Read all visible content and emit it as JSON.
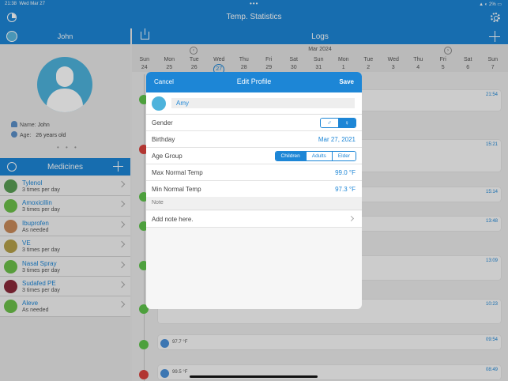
{
  "status": {
    "time": "21:38",
    "date": "Wed Mar 27",
    "dots": "•••",
    "battery": "2%"
  },
  "app": {
    "title": "Temp. Statistics"
  },
  "profile": {
    "name": "John",
    "name_label": "Name:",
    "name_value": "John",
    "age_label": "Age:",
    "age_value": "26 years old",
    "page_dots": "• • •"
  },
  "medicines": {
    "title": "Medicines",
    "items": [
      {
        "name": "Tylenol",
        "freq": "3 times per day",
        "color": "#5a9e55"
      },
      {
        "name": "Amoxicillin",
        "freq": "3 times per day",
        "color": "#6cc04a"
      },
      {
        "name": "Ibuprofen",
        "freq": "As needed",
        "color": "#c88a5a"
      },
      {
        "name": "VE",
        "freq": "3 times per day",
        "color": "#b5a04a"
      },
      {
        "name": "Nasal Spray",
        "freq": "3 times per day",
        "color": "#6cc04a"
      },
      {
        "name": "Sudafed PE",
        "freq": "3 times per day",
        "color": "#8a2a3a"
      },
      {
        "name": "Aleve",
        "freq": "As needed",
        "color": "#6cc04a"
      }
    ]
  },
  "logs": {
    "title": "Logs",
    "month": "Mar 2024",
    "prev": "‹",
    "next": "›",
    "days": [
      {
        "dow": "Sun",
        "num": "24"
      },
      {
        "dow": "Mon",
        "num": "25"
      },
      {
        "dow": "Tue",
        "num": "26"
      },
      {
        "dow": "Wed",
        "num": "27"
      },
      {
        "dow": "Thu",
        "num": "28"
      },
      {
        "dow": "Fri",
        "num": "29"
      },
      {
        "dow": "Sat",
        "num": "30"
      },
      {
        "dow": "Sun",
        "num": "31"
      },
      {
        "dow": "Mon",
        "num": "1"
      },
      {
        "dow": "Tue",
        "num": "2"
      },
      {
        "dow": "Wed",
        "num": "3"
      },
      {
        "dow": "Thu",
        "num": "4"
      },
      {
        "dow": "Fri",
        "num": "5"
      },
      {
        "dow": "Sat",
        "num": "6"
      },
      {
        "dow": "Sun",
        "num": "7"
      }
    ],
    "entries": [
      {
        "time": "21:54",
        "text": ""
      },
      {
        "time": "15:21",
        "text": ""
      },
      {
        "time": "15:14",
        "text": ""
      },
      {
        "time": "13:48",
        "text": ""
      },
      {
        "time": "13:09",
        "text": ""
      },
      {
        "time": "10:23",
        "text": ""
      },
      {
        "time": "09:54",
        "text": "97.7 °F"
      },
      {
        "time": "08:49",
        "text": "99.5 °F"
      }
    ]
  },
  "modal": {
    "cancel": "Cancel",
    "title": "Edit Profile",
    "save": "Save",
    "name_value": "Amy",
    "gender_label": "Gender",
    "gender_male": "♂",
    "gender_female": "♀",
    "birthday_label": "Birthday",
    "birthday_value": "Mar 27, 2021",
    "age_group_label": "Age Group",
    "age_groups": [
      "Children",
      "Adults",
      "Elder"
    ],
    "max_label": "Max Normal Temp",
    "max_value": "99.0 °F",
    "min_label": "Min Normal Temp",
    "min_value": "97.3 °F",
    "note_header": "Note",
    "note_placeholder": "Add note here."
  },
  "colors": {
    "accent": "#1d86d6",
    "ok": "#5ec44b",
    "bad": "#d9433e"
  }
}
